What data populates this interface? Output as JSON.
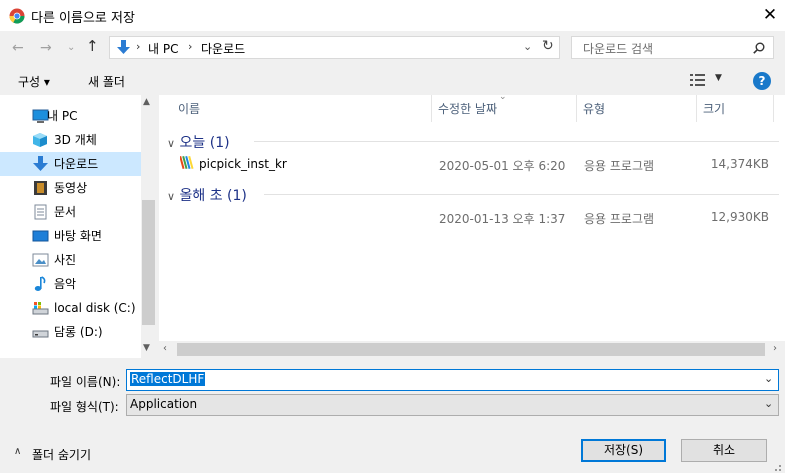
{
  "window": {
    "title": "다른 이름으로 저장",
    "close_label": "✕"
  },
  "address": {
    "crumbs": [
      "내 PC",
      "다운로드"
    ],
    "separator": "›",
    "search_placeholder": "다운로드 검색"
  },
  "toolbar": {
    "organize_label": "구성 ▾",
    "new_folder_label": "새 폴더",
    "help_label": "?"
  },
  "nav": {
    "items": [
      {
        "label": "내 PC",
        "icon": "computer-icon"
      },
      {
        "label": "3D 개체",
        "icon": "cube-icon"
      },
      {
        "label": "다운로드",
        "icon": "download-arrow-icon"
      },
      {
        "label": "동영상",
        "icon": "video-icon"
      },
      {
        "label": "문서",
        "icon": "document-icon"
      },
      {
        "label": "바탕 화면",
        "icon": "desktop-icon"
      },
      {
        "label": "사진",
        "icon": "picture-icon"
      },
      {
        "label": "음악",
        "icon": "music-icon"
      },
      {
        "label": "local disk (C:)",
        "icon": "drive-c-icon"
      },
      {
        "label": "담롱 (D:)",
        "icon": "drive-d-icon"
      }
    ]
  },
  "columns": {
    "name": "이름",
    "modified": "수정한 날짜",
    "type": "유형",
    "size": "크기"
  },
  "groups": [
    {
      "label": "오늘 (1)",
      "rows": [
        {
          "name": "picpick_inst_kr",
          "modified": "2020-05-01 오후 6:20",
          "type": "응용 프로그램",
          "size": "14,374KB"
        }
      ]
    },
    {
      "label": "올해 초 (1)",
      "rows": [
        {
          "name": "",
          "modified": "2020-01-13 오후 1:37",
          "type": "응용 프로그램",
          "size": "12,930KB"
        }
      ]
    }
  ],
  "form": {
    "filename_label": "파일 이름(N):",
    "filename_value": "ReflectDLHF",
    "filetype_label": "파일 형식(T):",
    "filetype_value": "Application"
  },
  "footer": {
    "hide_folders_label": "폴더 숨기기",
    "save_label": "저장(S)",
    "cancel_label": "취소"
  },
  "colors": {
    "accent": "#0078d7",
    "selected": "#cce8ff",
    "group_header": "#1e3287"
  }
}
